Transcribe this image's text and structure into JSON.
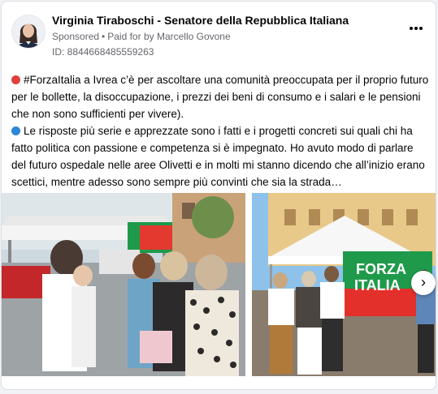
{
  "post": {
    "page_name": "Virginia Tiraboschi - Senatore della Repubblica Italiana",
    "sponsored_label": "Sponsored",
    "separator": "•",
    "paid_for_label": "Paid for by Marcello Govone",
    "ad_id": "ID: 8844668485559263",
    "more_icon": "more-horizontal-icon",
    "paragraph_1": "#ForzaItalia a Ivrea c’è per ascoltare una comunità preoccupata per il proprio futuro per le bollette, la disoccupazione, i prezzi dei beni di consumo e i salari e le pensioni che non sono sufficienti per vivere).",
    "paragraph_2": "Le risposte più serie e apprezzate sono i fatti e i progetti concreti sui quali chi ha fatto politica con passione e competenza si è impegnato. Ho avuto modo di parlare del futuro ospedale nelle aree Olivetti e in molti mi stanno dicendo che all’inizio erano scettici, mentre adesso sono sempre più convinti che sia la strada…",
    "bullet_1_color": "#e0403c",
    "bullet_2_color": "#2d86d8"
  },
  "carousel": {
    "banner_text_1": "FORZA",
    "banner_text_2": "ITALIA",
    "next_icon": "chevron-right-icon",
    "next_symbol": "›"
  }
}
